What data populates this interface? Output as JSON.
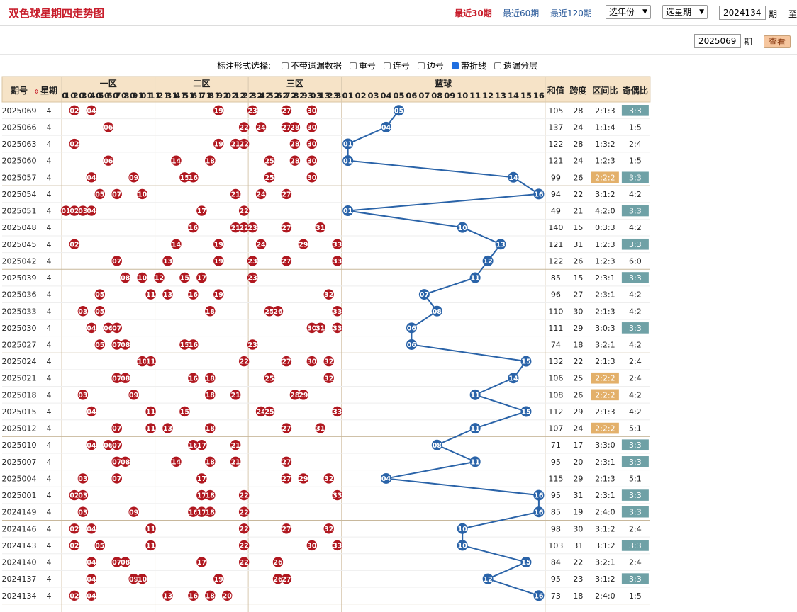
{
  "header": {
    "title": "双色球星期四走势图",
    "nav": [
      "最近30期",
      "最近60期",
      "最近120期"
    ],
    "year_select": "选年份",
    "week_select": "选星期",
    "period_from": "2024134",
    "period_label": "期",
    "to_label": "至",
    "period_to": "2025069",
    "period_label2": "期",
    "view_button": "查看"
  },
  "options": {
    "label": "标注形式选择:",
    "items": [
      {
        "label": "不带遗漏数据",
        "checked": false
      },
      {
        "label": "重号",
        "checked": false
      },
      {
        "label": "连号",
        "checked": false
      },
      {
        "label": "边号",
        "checked": false
      },
      {
        "label": "带折线",
        "checked": true
      },
      {
        "label": "遗漏分层",
        "checked": false
      }
    ]
  },
  "table": {
    "col_period": "期号",
    "col_weekday": "星期",
    "zones": [
      "一区",
      "二区",
      "三区"
    ],
    "blue_label": "蓝球",
    "col_sum": "和值",
    "col_span": "跨度",
    "col_ratio": "区间比",
    "col_parity": "奇偶比",
    "red_numbers": [
      "01",
      "02",
      "03",
      "04",
      "05",
      "06",
      "07",
      "08",
      "09",
      "10",
      "11",
      "12",
      "13",
      "14",
      "15",
      "16",
      "17",
      "18",
      "19",
      "20",
      "21",
      "22",
      "23",
      "24",
      "25",
      "26",
      "27",
      "28",
      "29",
      "30",
      "31",
      "32",
      "33"
    ],
    "blue_numbers": [
      "01",
      "02",
      "03",
      "04",
      "05",
      "06",
      "07",
      "08",
      "09",
      "10",
      "11",
      "12",
      "13",
      "14",
      "15",
      "16"
    ],
    "rows": [
      {
        "period": "2025069",
        "weekday": "4",
        "red": [
          2,
          4,
          19,
          23,
          27,
          30
        ],
        "blue": 5,
        "sum": "105",
        "span": "28",
        "ratio": "2:1:3",
        "parity": "3:3"
      },
      {
        "period": "2025066",
        "weekday": "4",
        "red": [
          6,
          22,
          24,
          27,
          28,
          30
        ],
        "blue": 4,
        "sum": "137",
        "span": "24",
        "ratio": "1:1:4",
        "parity": "1:5"
      },
      {
        "period": "2025063",
        "weekday": "4",
        "red": [
          2,
          19,
          21,
          22,
          28,
          30
        ],
        "blue": 1,
        "sum": "122",
        "span": "28",
        "ratio": "1:3:2",
        "parity": "2:4"
      },
      {
        "period": "2025060",
        "weekday": "4",
        "red": [
          6,
          14,
          18,
          25,
          28,
          30
        ],
        "blue": 1,
        "sum": "121",
        "span": "24",
        "ratio": "1:2:3",
        "parity": "1:5"
      },
      {
        "period": "2025057",
        "weekday": "4",
        "red": [
          4,
          9,
          15,
          16,
          25,
          30
        ],
        "blue": 14,
        "sum": "99",
        "span": "26",
        "ratio": "2:2:2",
        "parity": "3:3"
      },
      {
        "period": "2025054",
        "weekday": "4",
        "red": [
          5,
          7,
          10,
          21,
          24,
          27
        ],
        "blue": 16,
        "sum": "94",
        "span": "22",
        "ratio": "3:1:2",
        "parity": "4:2"
      },
      {
        "period": "2025051",
        "weekday": "4",
        "red": [
          1,
          2,
          3,
          4,
          17,
          22
        ],
        "blue": 1,
        "sum": "49",
        "span": "21",
        "ratio": "4:2:0",
        "parity": "3:3"
      },
      {
        "period": "2025048",
        "weekday": "4",
        "red": [
          16,
          21,
          22,
          27,
          31,
          23
        ],
        "blue": 10,
        "sum": "140",
        "span": "15",
        "ratio": "0:3:3",
        "parity": "4:2"
      },
      {
        "period": "2025045",
        "weekday": "4",
        "red": [
          2,
          14,
          19,
          24,
          29,
          33
        ],
        "blue": 13,
        "sum": "121",
        "span": "31",
        "ratio": "1:2:3",
        "parity": "3:3"
      },
      {
        "period": "2025042",
        "weekday": "4",
        "red": [
          7,
          13,
          19,
          23,
          27,
          33
        ],
        "blue": 12,
        "sum": "122",
        "span": "26",
        "ratio": "1:2:3",
        "parity": "6:0"
      },
      {
        "period": "2025039",
        "weekday": "4",
        "red": [
          8,
          10,
          12,
          15,
          17,
          23
        ],
        "blue": 11,
        "sum": "85",
        "span": "15",
        "ratio": "2:3:1",
        "parity": "3:3"
      },
      {
        "period": "2025036",
        "weekday": "4",
        "red": [
          5,
          11,
          13,
          16,
          19,
          32
        ],
        "blue": 7,
        "sum": "96",
        "span": "27",
        "ratio": "2:3:1",
        "parity": "4:2"
      },
      {
        "period": "2025033",
        "weekday": "4",
        "red": [
          3,
          5,
          18,
          25,
          26,
          33
        ],
        "blue": 8,
        "sum": "110",
        "span": "30",
        "ratio": "2:1:3",
        "parity": "4:2"
      },
      {
        "period": "2025030",
        "weekday": "4",
        "red": [
          4,
          6,
          7,
          30,
          31,
          33
        ],
        "blue": 6,
        "sum": "111",
        "span": "29",
        "ratio": "3:0:3",
        "parity": "3:3"
      },
      {
        "period": "2025027",
        "weekday": "4",
        "red": [
          5,
          7,
          8,
          15,
          16,
          23
        ],
        "blue": 6,
        "sum": "74",
        "span": "18",
        "ratio": "3:2:1",
        "parity": "4:2"
      },
      {
        "period": "2025024",
        "weekday": "4",
        "red": [
          10,
          11,
          22,
          27,
          30,
          32
        ],
        "blue": 15,
        "sum": "132",
        "span": "22",
        "ratio": "2:1:3",
        "parity": "2:4"
      },
      {
        "period": "2025021",
        "weekday": "4",
        "red": [
          7,
          8,
          16,
          18,
          25,
          32
        ],
        "blue": 14,
        "sum": "106",
        "span": "25",
        "ratio": "2:2:2",
        "parity": "2:4"
      },
      {
        "period": "2025018",
        "weekday": "4",
        "red": [
          3,
          9,
          18,
          21,
          28,
          29
        ],
        "blue": 11,
        "sum": "108",
        "span": "26",
        "ratio": "2:2:2",
        "parity": "4:2"
      },
      {
        "period": "2025015",
        "weekday": "4",
        "red": [
          4,
          11,
          15,
          24,
          25,
          33
        ],
        "blue": 15,
        "sum": "112",
        "span": "29",
        "ratio": "2:1:3",
        "parity": "4:2"
      },
      {
        "period": "2025012",
        "weekday": "4",
        "red": [
          7,
          11,
          13,
          18,
          27,
          31
        ],
        "blue": 11,
        "sum": "107",
        "span": "24",
        "ratio": "2:2:2",
        "parity": "5:1"
      },
      {
        "period": "2025010",
        "weekday": "4",
        "red": [
          4,
          6,
          7,
          16,
          17,
          21
        ],
        "blue": 8,
        "sum": "71",
        "span": "17",
        "ratio": "3:3:0",
        "parity": "3:3"
      },
      {
        "period": "2025007",
        "weekday": "4",
        "red": [
          7,
          8,
          14,
          18,
          21,
          27
        ],
        "blue": 11,
        "sum": "95",
        "span": "20",
        "ratio": "2:3:1",
        "parity": "3:3"
      },
      {
        "period": "2025004",
        "weekday": "4",
        "red": [
          3,
          7,
          17,
          27,
          29,
          32
        ],
        "blue": 4,
        "sum": "115",
        "span": "29",
        "ratio": "2:1:3",
        "parity": "5:1"
      },
      {
        "period": "2025001",
        "weekday": "4",
        "red": [
          2,
          3,
          17,
          18,
          22,
          33
        ],
        "blue": 16,
        "sum": "95",
        "span": "31",
        "ratio": "2:3:1",
        "parity": "3:3"
      },
      {
        "period": "2024149",
        "weekday": "4",
        "red": [
          3,
          9,
          16,
          17,
          18,
          22
        ],
        "blue": 16,
        "sum": "85",
        "span": "19",
        "ratio": "2:4:0",
        "parity": "3:3"
      },
      {
        "period": "2024146",
        "weekday": "4",
        "red": [
          2,
          4,
          11,
          22,
          27,
          32
        ],
        "blue": 10,
        "sum": "98",
        "span": "30",
        "ratio": "3:1:2",
        "parity": "2:4"
      },
      {
        "period": "2024143",
        "weekday": "4",
        "red": [
          2,
          5,
          11,
          22,
          30,
          33
        ],
        "blue": 10,
        "sum": "103",
        "span": "31",
        "ratio": "3:1:2",
        "parity": "3:3"
      },
      {
        "period": "2024140",
        "weekday": "4",
        "red": [
          4,
          7,
          8,
          17,
          22,
          26
        ],
        "blue": 15,
        "sum": "84",
        "span": "22",
        "ratio": "3:2:1",
        "parity": "2:4"
      },
      {
        "period": "2024137",
        "weekday": "4",
        "red": [
          4,
          9,
          10,
          19,
          26,
          27
        ],
        "blue": 12,
        "sum": "95",
        "span": "23",
        "ratio": "3:1:2",
        "parity": "3:3"
      },
      {
        "period": "2024134",
        "weekday": "4",
        "red": [
          2,
          4,
          13,
          16,
          18,
          20
        ],
        "blue": 16,
        "sum": "73",
        "span": "18",
        "ratio": "2:4:0",
        "parity": "1:5"
      }
    ]
  },
  "colors": {
    "red_ball": "#b0171f",
    "blue_ball": "#2a63a8",
    "header_bg": "#f6e3c7",
    "parity_highlight": "#6fa1a6",
    "ratio_highlight": "#e3b06a",
    "title_red": "#c81e2c",
    "link_blue": "#2a5a9a"
  }
}
